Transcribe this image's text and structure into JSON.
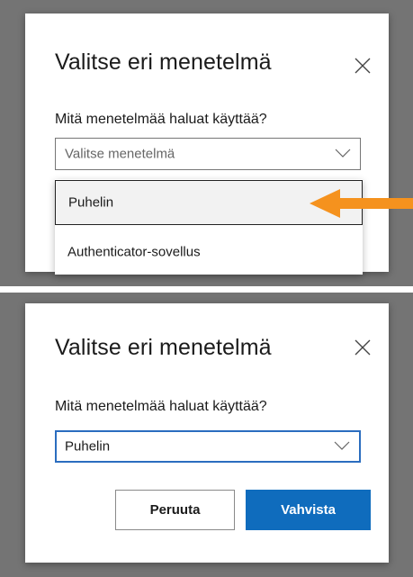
{
  "colors": {
    "accent": "#0f6cbd",
    "arrow": "#f5921e",
    "focus_border": "#2b6dbf"
  },
  "dialog_open": {
    "title": "Valitse eri menetelmä",
    "close_icon": "close-icon",
    "question": "Mitä menetelmää haluat käyttää?",
    "select_placeholder": "Valitse menetelmä",
    "chevron_icon": "chevron-down-icon",
    "options": [
      {
        "label": "Puhelin",
        "highlighted": true
      },
      {
        "label": "Authenticator-sovellus",
        "highlighted": false
      }
    ],
    "pointer_icon": "arrow-left-icon"
  },
  "dialog_selected": {
    "title": "Valitse eri menetelmä",
    "close_icon": "close-icon",
    "question": "Mitä menetelmää haluat käyttää?",
    "select_value": "Puhelin",
    "chevron_icon": "chevron-down-icon",
    "cancel_label": "Peruuta",
    "confirm_label": "Vahvista"
  }
}
